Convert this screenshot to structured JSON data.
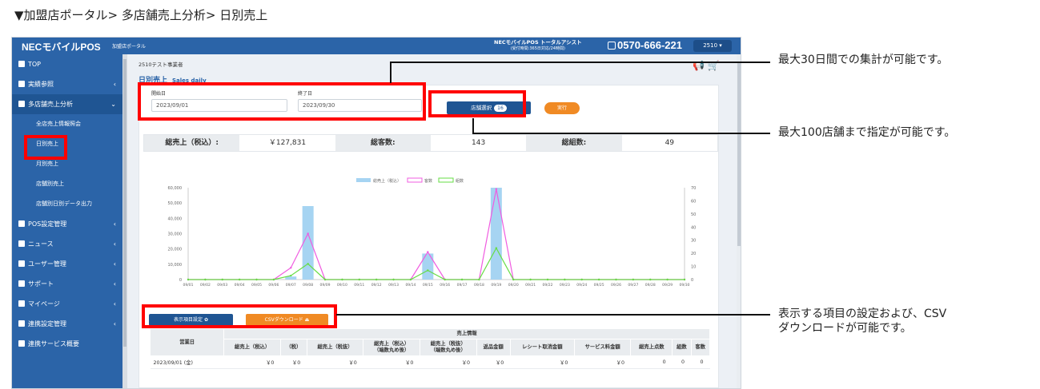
{
  "breadcrumb": "▼加盟店ポータル> 多店舗売上分析> 日別売上",
  "header": {
    "logo": "NECモバイルPOS",
    "logo_sub": "加盟店ポータル",
    "assist_title": "NECモバイルPOS トータルアシスト",
    "assist_sub": "(受付時間:365日対応/24時間)",
    "phone": "0570-666-221",
    "store_code": "2510 ▾"
  },
  "sidebar": {
    "items": [
      {
        "label": "TOP",
        "icon": "home-icon"
      },
      {
        "label": "実績参照",
        "icon": "list-icon"
      },
      {
        "label": "多店舗売上分析",
        "icon": "database-icon"
      },
      {
        "label": "POS設定管理",
        "icon": "gear-icon"
      },
      {
        "label": "ニュース",
        "icon": "megaphone-icon"
      },
      {
        "label": "ユーザー管理",
        "icon": "users-icon"
      },
      {
        "label": "サポート",
        "icon": "lifebuoy-icon"
      },
      {
        "label": "マイページ",
        "icon": "idcard-icon"
      },
      {
        "label": "連携設定管理",
        "icon": "edit-icon"
      },
      {
        "label": "連携サービス概要",
        "icon": "book-icon"
      }
    ],
    "sub_items": [
      "全店売上情報照会",
      "日別売上",
      "月別売上",
      "店舗別売上",
      "店舗別日別データ出力"
    ]
  },
  "main": {
    "store_name": "2510テスト事業者",
    "page_title": "日別売上",
    "page_title_en": "Sales daily",
    "start_label": "開始日",
    "end_label": "終了日",
    "start_date": "2023/09/01",
    "end_date": "2023/09/30",
    "store_select_label": "店舗選択",
    "store_count": "16",
    "run_label": "実行",
    "summary": {
      "sales_label": "総売上（税込）:",
      "sales_value": "￥127,831",
      "customers_label": "総客数:",
      "customers_value": "143",
      "groups_label": "総組数:",
      "groups_value": "49"
    },
    "cols_button": "表示項目設定 ✿",
    "csv_button": "CSVダウンロード ⏏"
  },
  "table": {
    "group_header": "売上情報",
    "headers": [
      "営業日",
      "総売上（税込）",
      "（税）",
      "総売上（税抜）",
      "総売上（税込）\n（端数丸め後）",
      "総売上（税抜）\n（端数丸め後）",
      "返品金額",
      "レシート取消金額",
      "サービス料金額",
      "総売上点数",
      "組数",
      "客数"
    ],
    "rows": [
      [
        "2023/09/01 (金)",
        "￥0",
        "￥0",
        "￥0",
        "￥0",
        "￥0",
        "￥0",
        "￥0",
        "￥0",
        "0",
        "0",
        "0"
      ]
    ]
  },
  "callouts": {
    "c1": "最大30日間での集計が可能です。",
    "c2": "最大100店舗まで指定が可能です。",
    "c3a": "表示する項目の設定および、CSV",
    "c3b": "ダウンロードが可能です。"
  },
  "colors": {
    "brand": "#2b64a8",
    "accent": "#f08a24",
    "highlight": "#ff0000"
  },
  "chart_data": {
    "type": "bar",
    "categories": [
      "09/01",
      "09/02",
      "09/03",
      "09/04",
      "09/05",
      "09/06",
      "09/07",
      "09/08",
      "09/09",
      "09/10",
      "09/11",
      "09/12",
      "09/13",
      "09/14",
      "09/15",
      "09/16",
      "09/17",
      "09/18",
      "09/19",
      "09/20",
      "09/21",
      "09/22",
      "09/23",
      "09/24",
      "09/25",
      "09/26",
      "09/27",
      "09/28",
      "09/29",
      "09/30"
    ],
    "series": [
      {
        "name": "総売上（税込）",
        "type": "bar",
        "axis": "left",
        "color": "#a6d4f2",
        "values": [
          0,
          0,
          0,
          0,
          0,
          0,
          2000,
          48000,
          0,
          0,
          0,
          0,
          0,
          0,
          17000,
          0,
          0,
          0,
          60000,
          0,
          0,
          0,
          0,
          0,
          0,
          0,
          0,
          0,
          0,
          0
        ]
      },
      {
        "name": "客数",
        "type": "line",
        "axis": "right",
        "color": "#f05ce0",
        "values": [
          0,
          0,
          0,
          0,
          0,
          0,
          9,
          35,
          0,
          0,
          0,
          0,
          0,
          0,
          21,
          0,
          0,
          0,
          69,
          0,
          0,
          0,
          0,
          0,
          0,
          0,
          0,
          0,
          0,
          0
        ]
      },
      {
        "name": "組数",
        "type": "line",
        "axis": "right",
        "color": "#66dd44",
        "values": [
          0,
          0,
          0,
          0,
          0,
          0,
          3,
          12,
          0,
          0,
          0,
          0,
          0,
          0,
          7,
          0,
          0,
          0,
          24,
          0,
          0,
          0,
          0,
          0,
          0,
          0,
          0,
          0,
          0,
          0
        ]
      }
    ],
    "ylim_left": [
      0,
      60000
    ],
    "ylim_right": [
      0,
      70
    ],
    "yticks_left": [
      "0",
      "10,000",
      "20,000",
      "30,000",
      "40,000",
      "50,000",
      "60,000"
    ],
    "yticks_right": [
      "0",
      "10",
      "20",
      "30",
      "40",
      "50",
      "60",
      "70"
    ],
    "legend": "top-center"
  }
}
